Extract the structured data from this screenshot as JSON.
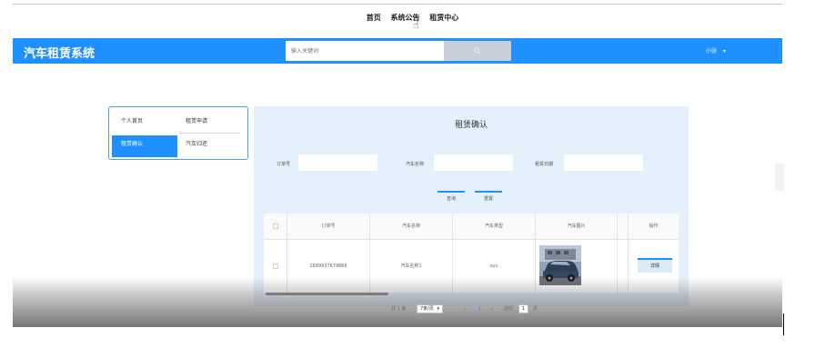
{
  "top_nav": {
    "items": [
      "首页",
      "系统公告",
      "租赁中心"
    ]
  },
  "header": {
    "brand": "汽车租赁系统",
    "search_placeholder": "输入关键词",
    "search_button_icon": "search-icon",
    "user_label": "小张",
    "user_caret": "▾",
    "color": "#1e90ff"
  },
  "sidebar_menu": {
    "items": [
      {
        "label": "个人首页",
        "active": false
      },
      {
        "label": "租赁申请",
        "active": false
      },
      {
        "label": "租赁确认",
        "active": true
      },
      {
        "label": "汽车归还",
        "active": false
      }
    ]
  },
  "panel": {
    "title": "租赁确认",
    "filters": {
      "order_no_label": "订单号",
      "car_name_label": "汽车名称",
      "rent_date_label": "租赁日期"
    },
    "buttons": {
      "query": "查询",
      "reset": "重置"
    }
  },
  "table": {
    "headers": [
      "",
      "订单号",
      "汽车名称",
      "汽车类型",
      "汽车图片",
      "",
      "操作"
    ],
    "rows": [
      {
        "order_no": "1699937679866",
        "car_name": "汽车名称1",
        "car_type": "suv",
        "action": "详情"
      }
    ]
  },
  "pager": {
    "total": "共 1 条",
    "page_size": "7条/页",
    "prev": "‹",
    "current": "1",
    "next": "›",
    "goto_label": "前往",
    "goto_value": "1",
    "page_suffix": "页"
  }
}
